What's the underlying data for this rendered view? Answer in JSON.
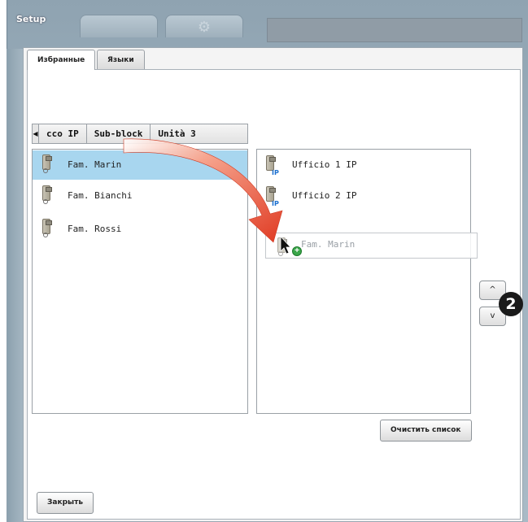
{
  "window": {
    "title": "Setup"
  },
  "top_tabs": [
    {
      "icon": "blank-tab-icon"
    },
    {
      "icon": "gear-icon"
    },
    {
      "icon": "handset-icon"
    }
  ],
  "tabs": [
    {
      "label": "Избранные",
      "active": true
    },
    {
      "label": "Языки",
      "active": false
    }
  ],
  "breadcrumb": {
    "items": [
      "cco IP",
      "Sub-block",
      "Unità 3"
    ]
  },
  "source_list": {
    "items": [
      {
        "label": "Fam. Marin",
        "selected": true,
        "icon": "handset-icon"
      },
      {
        "label": "Fam. Bianchi",
        "selected": false,
        "icon": "handset-icon"
      },
      {
        "label": "Fam. Rossi",
        "selected": false,
        "icon": "handset-icon"
      }
    ]
  },
  "favorites_list": {
    "items": [
      {
        "label": "Ufficio 1 IP",
        "badge": "IP",
        "icon": "ip-handset-icon"
      },
      {
        "label": "Ufficio 2 IP",
        "badge": "IP",
        "icon": "ip-handset-icon"
      }
    ],
    "drag_preview": {
      "label": "Fam. Marin",
      "icon": "add-plus-icon"
    }
  },
  "order_buttons": {
    "up": "^",
    "down": "v"
  },
  "clear_button": "Очистить список",
  "close_button": "Закрыть",
  "step_marker": "2",
  "colors": {
    "selection": "#a8d6ef",
    "arrow": "#e8492f",
    "plus": "#3aa64a",
    "ip_badge": "#1a6fd0"
  }
}
